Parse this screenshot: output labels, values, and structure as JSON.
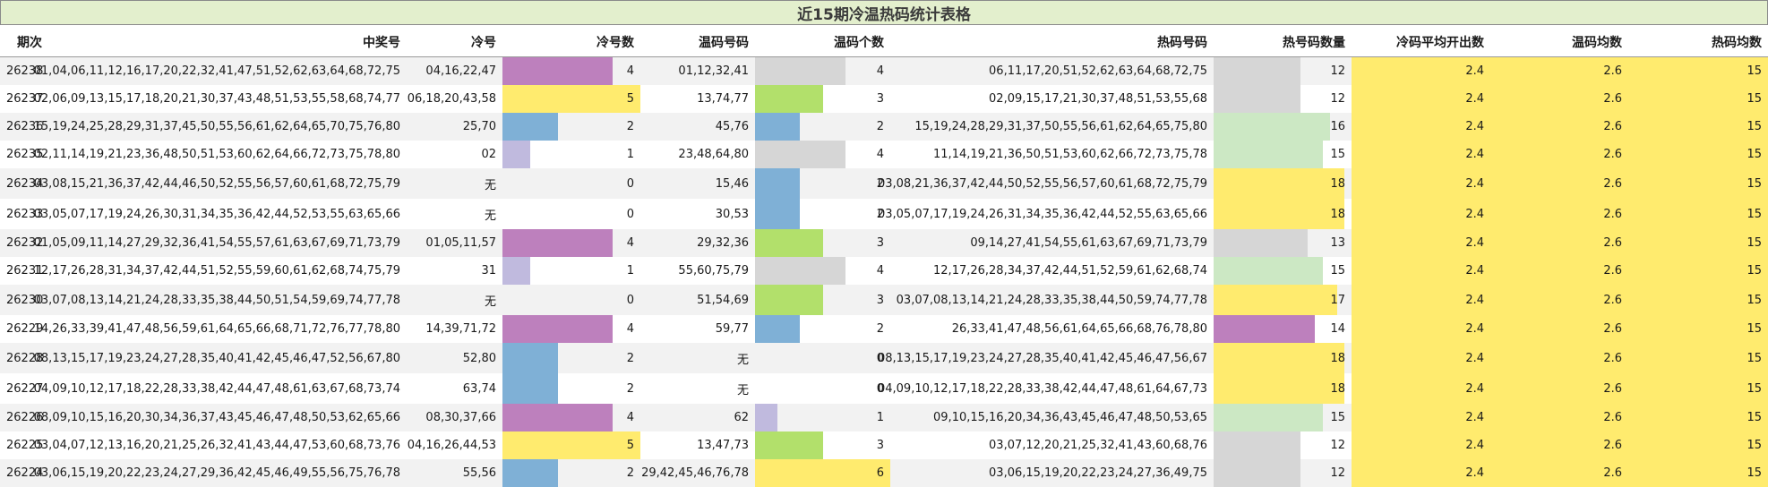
{
  "title": "近15期冷温热码统计表格",
  "headers": {
    "period": "期次",
    "winning": "中奖号",
    "cold": "冷号",
    "cold_count": "冷号数",
    "warm": "温码号码",
    "warm_count": "温码个数",
    "hot": "热码号码",
    "hot_count": "热号码数量",
    "cold_avg": "冷码平均开出数",
    "warm_avg": "温码均数",
    "hot_avg": "热码均数"
  },
  "colors": {
    "title_bg": "#e3efcd",
    "purple": "#bd80bd",
    "yellow": "#ffeb6e",
    "blue": "#7fb0d6",
    "lavender": "#c0bade",
    "gray": "#d6d6d6",
    "green": "#b2e06b",
    "light_green": "#cce8c4",
    "avg_bg": "#ffeb6e",
    "stripe": "#f2f2f2"
  },
  "rows": [
    {
      "period": "26238",
      "winning": "01,04,06,11,12,16,17,20,22,32,41,47,51,52,62,63,64,68,72,75",
      "cold": "04,16,22,47",
      "cold_count": "4",
      "cold_color": "purple",
      "warm": "01,12,32,41",
      "warm_count": "4",
      "warm_color": "gray",
      "hot": "06,11,17,20,51,52,62,63,64,68,72,75",
      "hot_count": "12",
      "hot_color": "gray",
      "cold_avg": "2.4",
      "warm_avg": "2.6",
      "hot_avg": "15"
    },
    {
      "period": "26237",
      "winning": "02,06,09,13,15,17,18,20,21,30,37,43,48,51,53,55,58,68,74,77",
      "cold": "06,18,20,43,58",
      "cold_count": "5",
      "cold_color": "yellow",
      "warm": "13,74,77",
      "warm_count": "3",
      "warm_color": "green",
      "hot": "02,09,15,17,21,30,37,48,51,53,55,68",
      "hot_count": "12",
      "hot_color": "gray",
      "cold_avg": "2.4",
      "warm_avg": "2.6",
      "hot_avg": "15"
    },
    {
      "period": "26236",
      "winning": "15,19,24,25,28,29,31,37,45,50,55,56,61,62,64,65,70,75,76,80",
      "cold": "25,70",
      "cold_count": "2",
      "cold_color": "blue",
      "warm": "45,76",
      "warm_count": "2",
      "warm_color": "blue",
      "hot": "15,19,24,28,29,31,37,50,55,56,61,62,64,65,75,80",
      "hot_count": "16",
      "hot_color": "light_green",
      "cold_avg": "2.4",
      "warm_avg": "2.6",
      "hot_avg": "15"
    },
    {
      "period": "26235",
      "winning": "02,11,14,19,21,23,36,48,50,51,53,60,62,64,66,72,73,75,78,80",
      "cold": "02",
      "cold_count": "1",
      "cold_color": "lavender",
      "warm": "23,48,64,80",
      "warm_count": "4",
      "warm_color": "gray",
      "hot": "11,14,19,21,36,50,51,53,60,62,66,72,73,75,78",
      "hot_count": "15",
      "hot_color": "light_green",
      "cold_avg": "2.4",
      "warm_avg": "2.6",
      "hot_avg": "15"
    },
    {
      "period": "26234",
      "winning": "03,08,15,21,36,37,42,44,46,50,52,55,56,57,60,61,68,72,75,79",
      "cold": "无",
      "cold_count": "0",
      "cold_color": "none",
      "warm": "15,46",
      "warm_count": "2",
      "warm_color": "blue",
      "hot": "03,08,21,36,37,42,44,50,52,55,56,57,60,61,68,72,75,79",
      "hot_count": "18",
      "hot_color": "yellow",
      "cold_avg": "2.4",
      "warm_avg": "2.6",
      "hot_avg": "15"
    },
    {
      "period": "26233",
      "winning": "03,05,07,17,19,24,26,30,31,34,35,36,42,44,52,53,55,63,65,66",
      "cold": "无",
      "cold_count": "0",
      "cold_color": "none",
      "warm": "30,53",
      "warm_count": "2",
      "warm_color": "blue",
      "hot": "03,05,07,17,19,24,26,31,34,35,36,42,44,52,55,63,65,66",
      "hot_count": "18",
      "hot_color": "yellow",
      "cold_avg": "2.4",
      "warm_avg": "2.6",
      "hot_avg": "15"
    },
    {
      "period": "26232",
      "winning": "01,05,09,11,14,27,29,32,36,41,54,55,57,61,63,67,69,71,73,79",
      "cold": "01,05,11,57",
      "cold_count": "4",
      "cold_color": "purple",
      "warm": "29,32,36",
      "warm_count": "3",
      "warm_color": "green",
      "hot": "09,14,27,41,54,55,61,63,67,69,71,73,79",
      "hot_count": "13",
      "hot_color": "gray",
      "cold_avg": "2.4",
      "warm_avg": "2.6",
      "hot_avg": "15"
    },
    {
      "period": "26231",
      "winning": "12,17,26,28,31,34,37,42,44,51,52,55,59,60,61,62,68,74,75,79",
      "cold": "31",
      "cold_count": "1",
      "cold_color": "lavender",
      "warm": "55,60,75,79",
      "warm_count": "4",
      "warm_color": "gray",
      "hot": "12,17,26,28,34,37,42,44,51,52,59,61,62,68,74",
      "hot_count": "15",
      "hot_color": "light_green",
      "cold_avg": "2.4",
      "warm_avg": "2.6",
      "hot_avg": "15"
    },
    {
      "period": "26230",
      "winning": "03,07,08,13,14,21,24,28,33,35,38,44,50,51,54,59,69,74,77,78",
      "cold": "无",
      "cold_count": "0",
      "cold_color": "none",
      "warm": "51,54,69",
      "warm_count": "3",
      "warm_color": "green",
      "hot": "03,07,08,13,14,21,24,28,33,35,38,44,50,59,74,77,78",
      "hot_count": "17",
      "hot_color": "yellow",
      "cold_avg": "2.4",
      "warm_avg": "2.6",
      "hot_avg": "15"
    },
    {
      "period": "26229",
      "winning": "14,26,33,39,41,47,48,56,59,61,64,65,66,68,71,72,76,77,78,80",
      "cold": "14,39,71,72",
      "cold_count": "4",
      "cold_color": "purple",
      "warm": "59,77",
      "warm_count": "2",
      "warm_color": "blue",
      "hot": "26,33,41,47,48,56,61,64,65,66,68,76,78,80",
      "hot_count": "14",
      "hot_color": "purple",
      "cold_avg": "2.4",
      "warm_avg": "2.6",
      "hot_avg": "15"
    },
    {
      "period": "26228",
      "winning": "08,13,15,17,19,23,24,27,28,35,40,41,42,45,46,47,52,56,67,80",
      "cold": "52,80",
      "cold_count": "2",
      "cold_color": "blue",
      "warm": "无",
      "warm_count": "0",
      "warm_color": "none",
      "hot": "08,13,15,17,19,23,24,27,28,35,40,41,42,45,46,47,56,67",
      "hot_count": "18",
      "hot_color": "yellow",
      "cold_avg": "2.4",
      "warm_avg": "2.6",
      "hot_avg": "15"
    },
    {
      "period": "26227",
      "winning": "04,09,10,12,17,18,22,28,33,38,42,44,47,48,61,63,67,68,73,74",
      "cold": "63,74",
      "cold_count": "2",
      "cold_color": "blue",
      "warm": "无",
      "warm_count": "0",
      "warm_color": "none",
      "hot": "04,09,10,12,17,18,22,28,33,38,42,44,47,48,61,64,67,73",
      "hot_count": "18",
      "hot_color": "yellow",
      "cold_avg": "2.4",
      "warm_avg": "2.6",
      "hot_avg": "15"
    },
    {
      "period": "26226",
      "winning": "08,09,10,15,16,20,30,34,36,37,43,45,46,47,48,50,53,62,65,66",
      "cold": "08,30,37,66",
      "cold_count": "4",
      "cold_color": "purple",
      "warm": "62",
      "warm_count": "1",
      "warm_color": "lavender",
      "hot": "09,10,15,16,20,34,36,43,45,46,47,48,50,53,65",
      "hot_count": "15",
      "hot_color": "light_green",
      "cold_avg": "2.4",
      "warm_avg": "2.6",
      "hot_avg": "15"
    },
    {
      "period": "26225",
      "winning": "03,04,07,12,13,16,20,21,25,26,32,41,43,44,47,53,60,68,73,76",
      "cold": "04,16,26,44,53",
      "cold_count": "5",
      "cold_color": "yellow",
      "warm": "13,47,73",
      "warm_count": "3",
      "warm_color": "green",
      "hot": "03,07,12,20,21,25,32,41,43,60,68,76",
      "hot_count": "12",
      "hot_color": "gray",
      "cold_avg": "2.4",
      "warm_avg": "2.6",
      "hot_avg": "15"
    },
    {
      "period": "26224",
      "winning": "03,06,15,19,20,22,23,24,27,29,36,42,45,46,49,55,56,75,76,78",
      "cold": "55,56",
      "cold_count": "2",
      "cold_color": "blue",
      "warm": "29,42,45,46,76,78",
      "warm_count": "6",
      "warm_color": "yellow",
      "hot": "03,06,15,19,20,22,23,24,27,36,49,75",
      "hot_count": "12",
      "hot_color": "gray",
      "cold_avg": "2.4",
      "warm_avg": "2.6",
      "hot_avg": "15"
    }
  ]
}
